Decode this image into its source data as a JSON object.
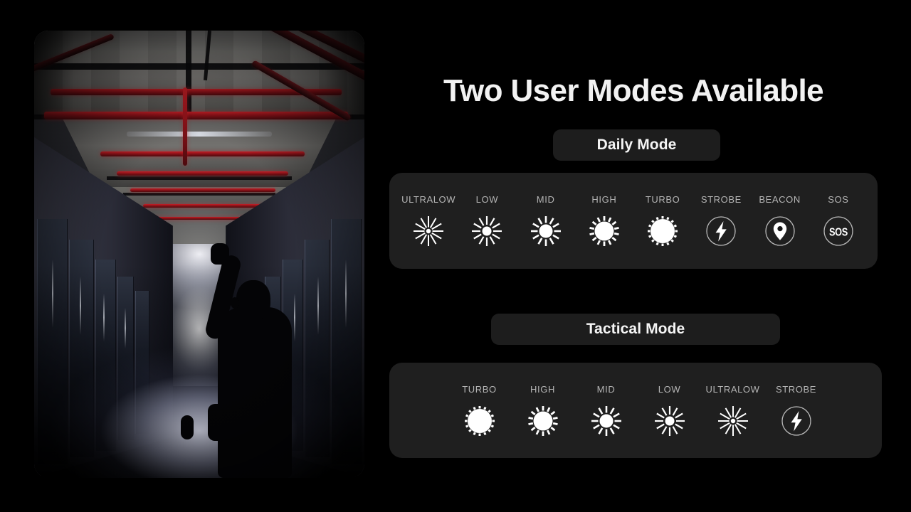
{
  "header": {
    "title": "Two User Modes Available"
  },
  "photo": {
    "alt_name": "flashlight-corridor-photo"
  },
  "daily_mode": {
    "button_label": "Daily Mode",
    "modes": [
      {
        "label": "ULTRALOW",
        "icon": "sunburst-ultralow-icon"
      },
      {
        "label": "LOW",
        "icon": "sunburst-low-icon"
      },
      {
        "label": "MID",
        "icon": "sunburst-mid-icon"
      },
      {
        "label": "HIGH",
        "icon": "sunburst-high-icon"
      },
      {
        "label": "TURBO",
        "icon": "sunburst-turbo-icon"
      },
      {
        "label": "STROBE",
        "icon": "lightning-bolt-icon"
      },
      {
        "label": "BEACON",
        "icon": "location-pin-icon"
      },
      {
        "label": "SOS",
        "icon": "sos-icon"
      }
    ]
  },
  "tactical_mode": {
    "button_label": "Tactical Mode",
    "modes": [
      {
        "label": "TURBO",
        "icon": "sunburst-turbo-icon"
      },
      {
        "label": "HIGH",
        "icon": "sunburst-high-icon"
      },
      {
        "label": "MID",
        "icon": "sunburst-mid-icon"
      },
      {
        "label": "LOW",
        "icon": "sunburst-low-icon"
      },
      {
        "label": "ULTRALOW",
        "icon": "sunburst-ultralow-icon"
      },
      {
        "label": "STROBE",
        "icon": "lightning-bolt-icon"
      }
    ]
  },
  "colors": {
    "background": "#000000",
    "panel": "#1f1f1f",
    "button": "#1d1d1d",
    "label_text": "#b5b5b5",
    "title_text": "#f2f2f2",
    "icon": "#ffffff"
  }
}
